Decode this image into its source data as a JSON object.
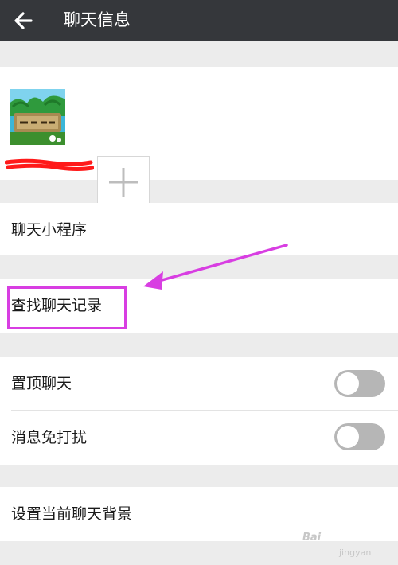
{
  "header": {
    "title": "聊天信息",
    "back_icon": "arrow-left-icon",
    "background": "#35373b"
  },
  "members": {
    "avatar_icon": "group-avatar-image",
    "add_icon": "plus-icon"
  },
  "menu": {
    "mini_programs": "聊天小程序",
    "search_history": "查找聊天记录",
    "pin_chat": "置顶聊天",
    "mute": "消息免打扰",
    "set_background": "设置当前聊天背景"
  },
  "toggles": {
    "pin_chat_on": false,
    "mute_on": false,
    "off_color": "#b6b6b6"
  },
  "annotation": {
    "highlight_color": "#d83ee2"
  },
  "watermark": {
    "text": "Bai",
    "subtext": "jingyan"
  }
}
